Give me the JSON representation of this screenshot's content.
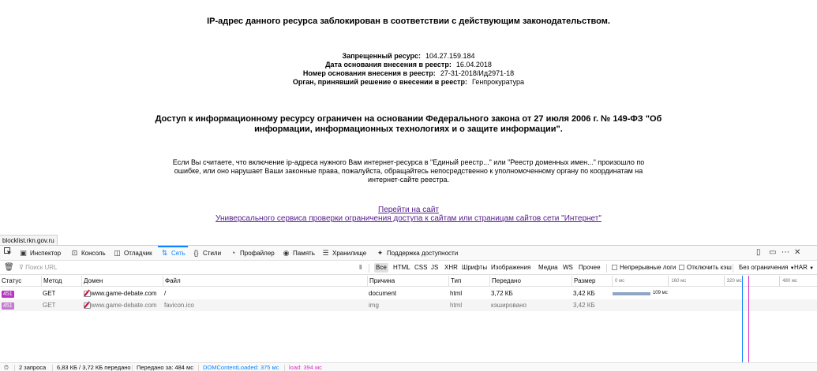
{
  "page": {
    "headline": "IP-адрес данного ресурса заблокирован в соответствии с действующим законодательством.",
    "info": [
      {
        "label": "Запрещенный ресурс:",
        "value": "104.27.159.184"
      },
      {
        "label": "Дата основания внесения в реестр:",
        "value": "16.04.2018"
      },
      {
        "label": "Номер основания внесения в реестр:",
        "value": "27-31-2018/Ид2971-18"
      },
      {
        "label": "Орган, принявший решение о внесении в реестр:",
        "value": "Генпрокуратура"
      }
    ],
    "law_line1": "Доступ к информационному ресурсу ограничен на основании Федерального закона от 27 июля 2006 г. № 149-ФЗ \"Об",
    "law_line2": "информации, информационных технологиях и о защите информации\".",
    "note_line1": "Если Вы считаете, что включение ip-адреса нужного Вам интернет-ресурса в \"Единый реестр...\" или \"Реестр доменных имен...\" произошло по",
    "note_line2": "ошибке, или оно нарушает Ваши законные права, пожалуйста, обращайтесь непосредственно к уполномоченному органу по координатам на",
    "note_line3": "интернет-сайте реестра.",
    "link1": "Перейти на сайт",
    "link2": "Универсального сервиса проверки ограничения доступа к сайтам или страницам сайтов сети \"Интернет\""
  },
  "status_url": "blocklist.rkn.gov.ru",
  "devtools": {
    "tabs": {
      "inspector": "Инспектор",
      "console": "Консоль",
      "debugger": "Отладчик",
      "network": "Сеть",
      "styles": "Стили",
      "profiler": "Профайлер",
      "memory": "Память",
      "storage": "Хранилище",
      "accessibility": "Поддержка доступности"
    },
    "filter_placeholder": "Поиск URL",
    "filter_types": {
      "all": "Все",
      "html": "HTML",
      "css": "CSS",
      "js": "JS",
      "xhr": "XHR",
      "fonts": "Шрифты",
      "images": "Изображения",
      "media": "Медиа",
      "ws": "WS",
      "other": "Прочее"
    },
    "persist_logs": "Непрерывные логи",
    "disable_cache": "Отключить кэш",
    "throttling": "Без ограничения",
    "har": "HAR",
    "columns": {
      "status": "Статус",
      "method": "Метод",
      "domain": "Домен",
      "file": "Файл",
      "cause": "Причина",
      "type": "Тип",
      "transferred": "Передано",
      "size": "Размер"
    },
    "waterfall_ticks": [
      "0 мс",
      "160 мс",
      "320 мс",
      "480 мс"
    ],
    "requests": [
      {
        "status": "451",
        "method": "GET",
        "domain": "www.game-debate.com",
        "file": "/",
        "cause": "document",
        "type": "html",
        "transferred": "3,72 КБ",
        "size": "3,42 КБ",
        "timing_label": "109 мс",
        "timing_ms": 109
      },
      {
        "status": "451",
        "method": "GET",
        "domain": "www.game-debate.com",
        "file": "favicon.ico",
        "cause": "img",
        "type": "html",
        "transferred": "кэшировано",
        "size": "3,42 КБ"
      }
    ],
    "footer": {
      "requests": "2 запроса",
      "transferred": "6,83 КБ / 3,72 КБ передано",
      "finish": "Передано за: 484 мс",
      "dom": "DOMContentLoaded: 375 мс",
      "load": "load: 394 мс"
    },
    "colors": {
      "accent": "#0a84ff",
      "dom_line": "#0a84ff",
      "load_line": "#e02bc9",
      "badge": "#b933c4"
    }
  }
}
